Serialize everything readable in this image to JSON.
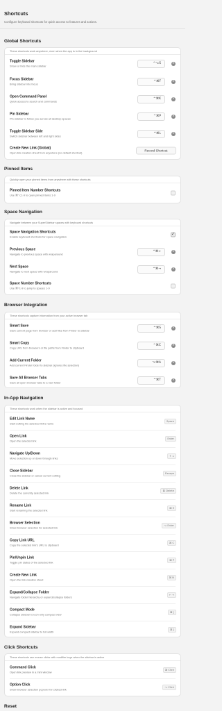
{
  "header": {
    "title": "Shortcuts",
    "subtitle": "Configure keyboard shortcuts for quick access to features and actions."
  },
  "global": {
    "title": "Global Shortcuts",
    "desc": "These shortcuts work anywhere, even when the app is in the background",
    "rows": [
      {
        "label": "Toggle Sidebar",
        "desc": "Show or hide the main sidebar",
        "key": "^⌥S"
      },
      {
        "label": "Focus Sidebar",
        "desc": "Bring sidebar into focus",
        "key": "^⌘F"
      },
      {
        "label": "Open Command Panel",
        "desc": "Quick access to search and commands",
        "key": "^⌘K"
      },
      {
        "label": "Pin Sidebar",
        "desc": "Pin sidebar to follow you across all desktop spaces",
        "key": "^⌘P"
      },
      {
        "label": "Toggle Sidebar Side",
        "desc": "Switch sidebar between left and right sides",
        "key": "^⌘L"
      }
    ],
    "record_row": {
      "label": "Create New Link (Global)",
      "desc": "Open link creation sheet from anywhere (no default shortcut)",
      "button": "Record Shortcut"
    }
  },
  "pinned": {
    "title": "Pinned Items",
    "desc": "Quickly open your pinned items from anywhere with these shortcuts",
    "rows": [
      {
        "label": "Pinned Item Number Shortcuts",
        "desc": "Use ⌘⌥1-9 to open pinned items 1-9",
        "checked": false
      }
    ]
  },
  "space": {
    "title": "Space Navigation",
    "desc": "Navigate between your SuperSidebar spaces with keyboard shortcuts",
    "rows": [
      {
        "type": "check",
        "label": "Space Navigation Shortcuts",
        "desc": "Enable keyboard shortcuts for space navigation",
        "checked": true
      },
      {
        "type": "key",
        "label": "Previous Space",
        "desc": "Navigate to previous space with wraparound",
        "key": "^⌘←"
      },
      {
        "type": "key",
        "label": "Next Space",
        "desc": "Navigate to next space with wraparound",
        "key": "^⌘→"
      },
      {
        "type": "check",
        "label": "Space Number Shortcuts",
        "desc": "Use ⌘^1-9 to jump to spaces 1-9",
        "checked": false
      }
    ]
  },
  "browser": {
    "title": "Browser Integration",
    "desc": "These shortcuts capture information from your active browser tab",
    "rows": [
      {
        "label": "Smart Save",
        "desc": "Save current page from browser or add files from Finder to sidebar",
        "key": "^⌘S"
      },
      {
        "label": "Smart Copy",
        "desc": "Copy URL from browsers or file paths from Finder to clipboard",
        "key": "^⌘C"
      },
      {
        "label": "Add Current Folder",
        "desc": "Add current Finder folder to sidebar (ignores file selection)",
        "key": "⌥⌘A"
      },
      {
        "label": "Save All Browser Tabs",
        "desc": "Save all open browser tabs to a new folder",
        "key": "^⌘T"
      }
    ]
  },
  "inapp": {
    "title": "In-App Navigation",
    "desc": "These shortcuts work when the sidebar is active and focused",
    "rows": [
      {
        "label": "Edit Link Name",
        "desc": "Start editing the selected link's name",
        "kbd": "Space"
      },
      {
        "label": "Open Link",
        "desc": "Open the selected link",
        "kbd": "Enter"
      },
      {
        "label": "Navigate Up/Down",
        "desc": "Move selection up or down through links",
        "kbd": "↑ ↓"
      },
      {
        "label": "Close Sidebar",
        "desc": "Close the sidebar or cancel current editing",
        "kbd": "Escape"
      },
      {
        "label": "Delete Link",
        "desc": "Delete the currently selected link",
        "kbd": "⌘ Delete"
      },
      {
        "label": "Rename Link",
        "desc": "Start renaming the selected link",
        "kbd": "⌘ E"
      },
      {
        "label": "Browser Selection",
        "desc": "Show browser selection for selected link",
        "kbd": "⌥ Enter"
      },
      {
        "label": "Copy Link URL",
        "desc": "Copy the selected link's URL to clipboard",
        "kbd": "⌘ C"
      },
      {
        "label": "Pin/Unpin Link",
        "desc": "Toggle pin status of the selected link",
        "kbd": "⌘ P"
      },
      {
        "label": "Create New Link",
        "desc": "Open the link creation sheet",
        "kbd": "⌘ N"
      },
      {
        "label": "Expand/Collapse Folder",
        "desc": "Navigate folder hierarchy or expand/collapse folders",
        "kbd": "← →"
      },
      {
        "label": "Compact Mode",
        "desc": "Collapse sidebar to icon-only compact view",
        "kbd": "⌘ ["
      },
      {
        "label": "Expand Sidebar",
        "desc": "Expand compact sidebar to full width",
        "kbd": "⌘ ]"
      }
    ]
  },
  "click": {
    "title": "Click Shortcuts",
    "desc": "These shortcuts use mouse clicks with modifier keys when the sidebar is active",
    "rows": [
      {
        "label": "Command Click",
        "desc": "Open link preview in a mini window",
        "kbd": "⌘ Click"
      },
      {
        "label": "Option Click",
        "desc": "Show browser selection popover for clicked link",
        "kbd": "⌥ Click"
      }
    ]
  },
  "reset": {
    "title": "Reset"
  }
}
